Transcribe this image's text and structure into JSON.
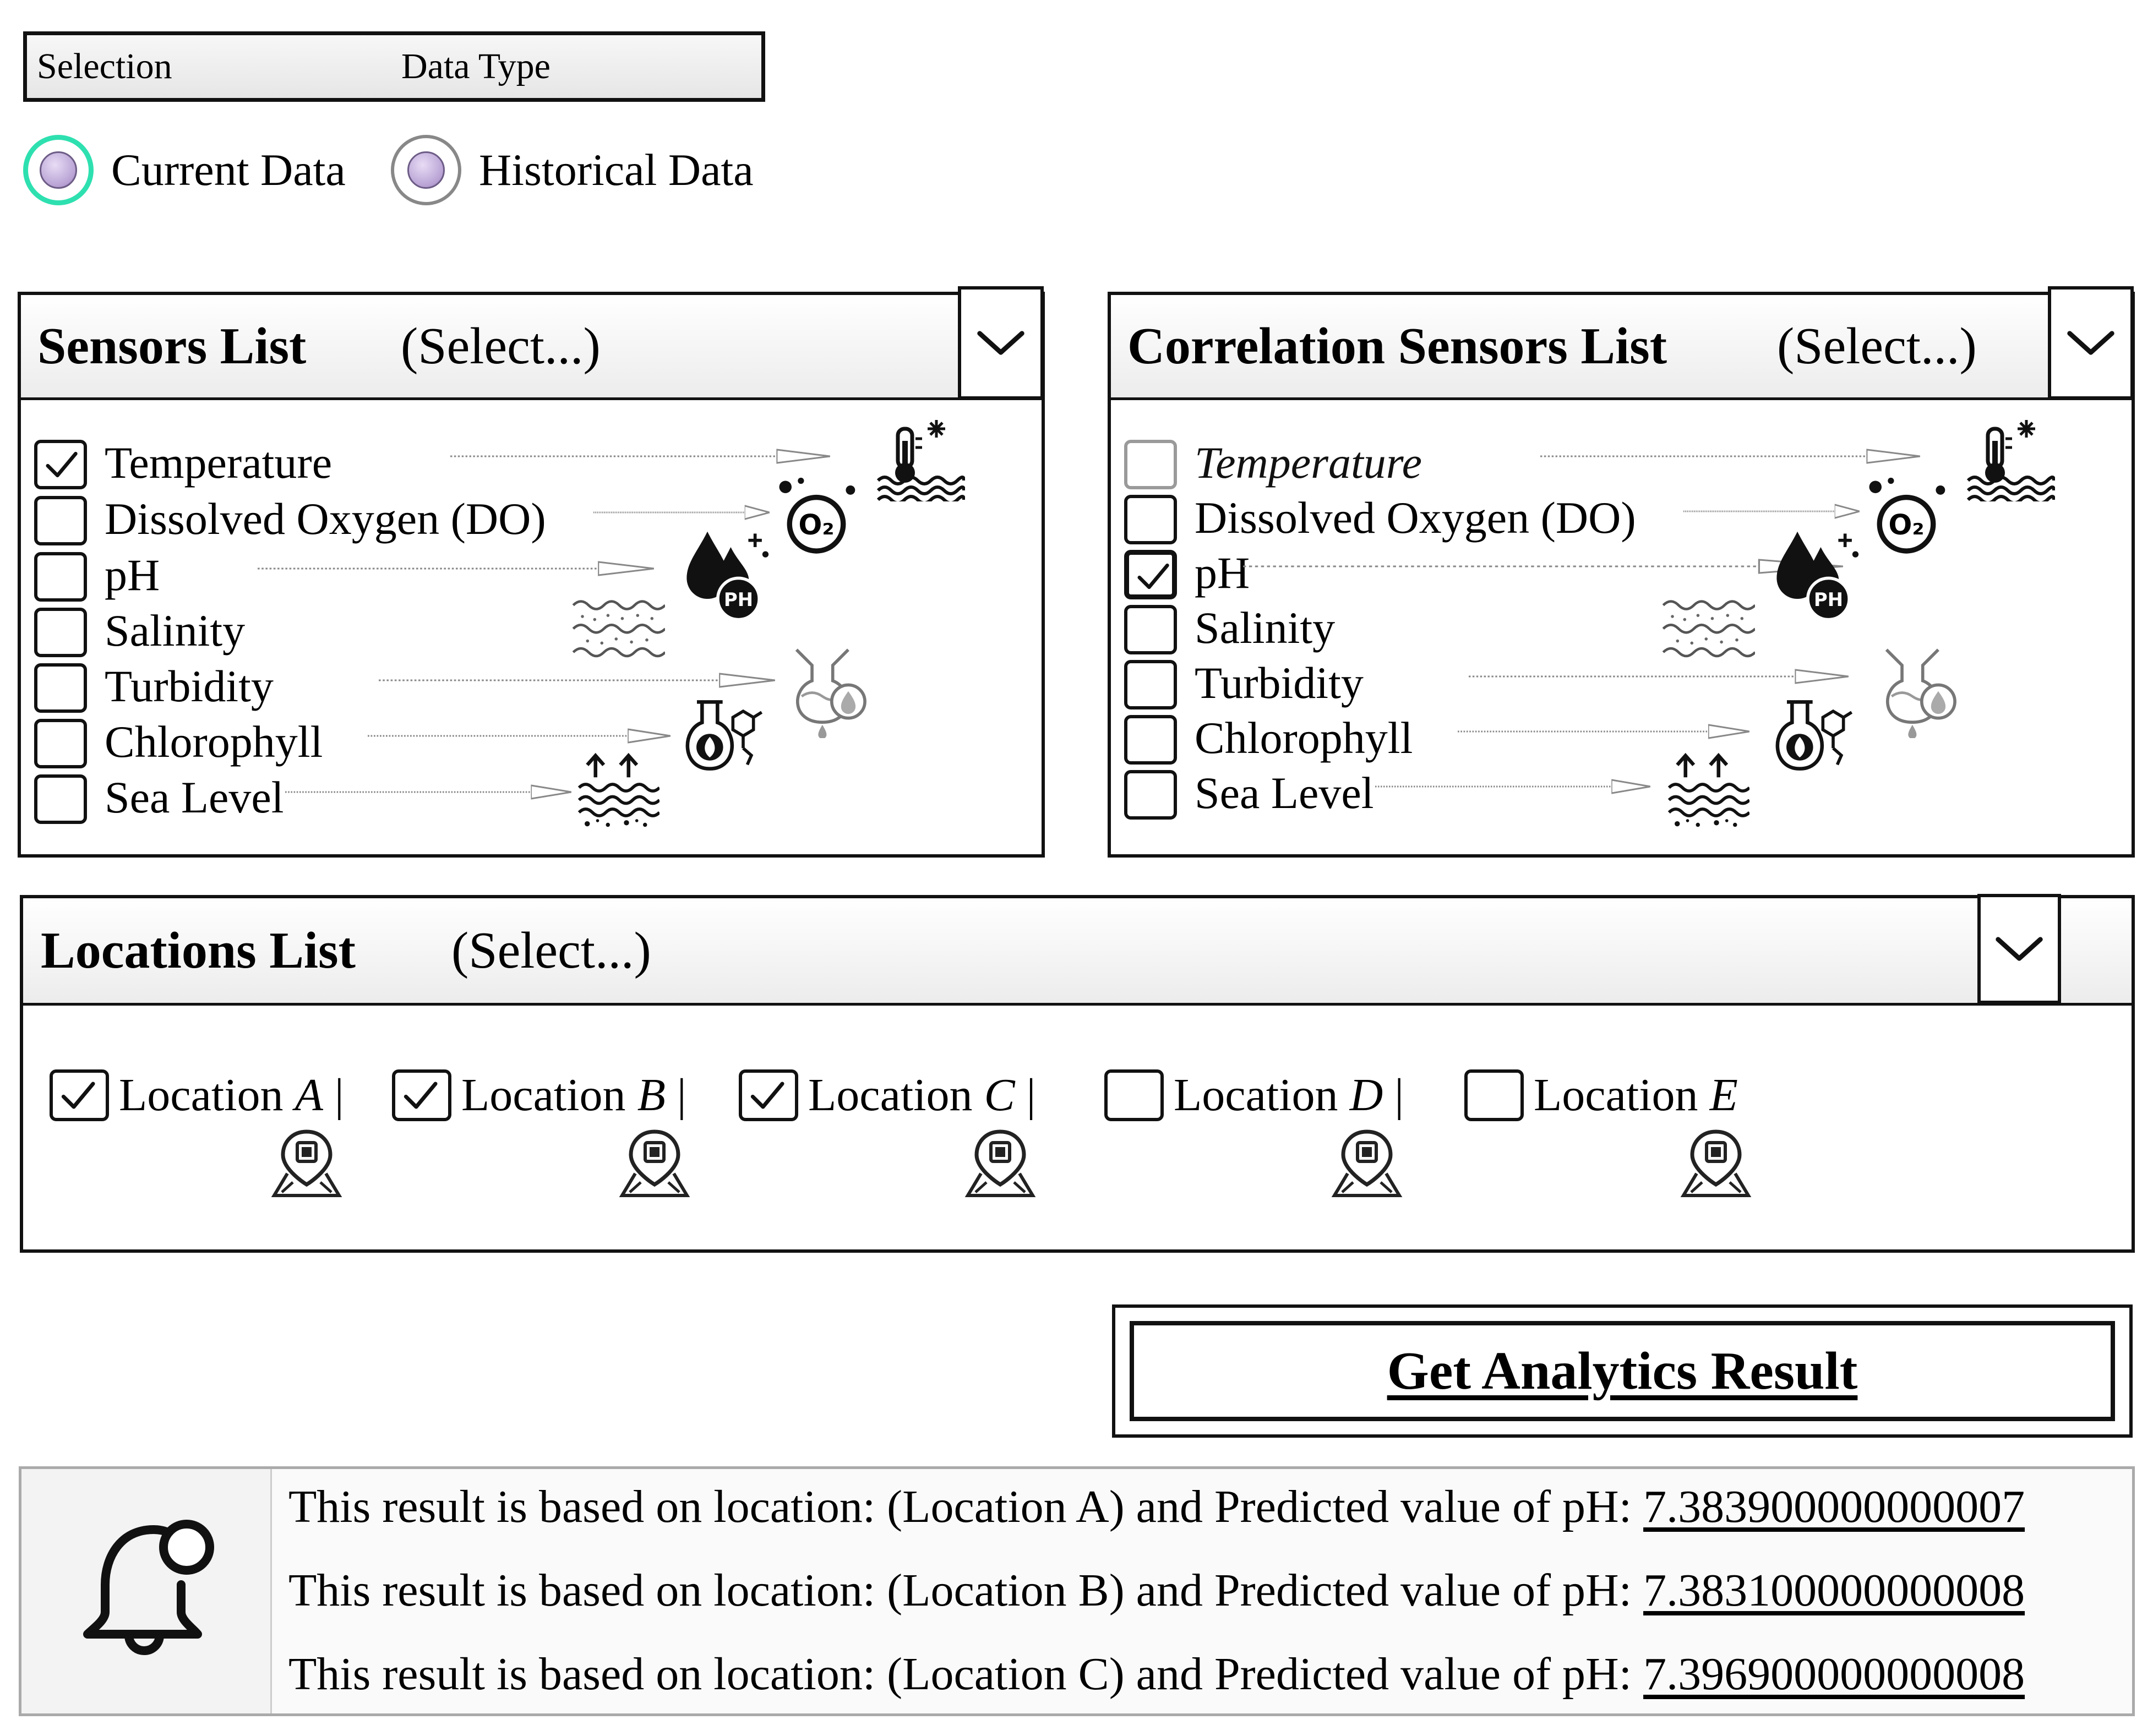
{
  "selection": {
    "label": "Selection",
    "data_type_label": "Data Type"
  },
  "data_type": {
    "options": [
      {
        "label": "Current Data",
        "selected": true
      },
      {
        "label": "Historical Data",
        "selected": false
      }
    ]
  },
  "sensors": {
    "title": "Sensors List",
    "select_label": "(Select...)",
    "items": [
      {
        "label": "Temperature",
        "checked": true,
        "icon": "thermometer-water-icon"
      },
      {
        "label": "Dissolved Oxygen (DO)",
        "checked": false,
        "icon": "oxygen-bubbles-icon"
      },
      {
        "label": "pH",
        "checked": false,
        "icon": "ph-drops-icon"
      },
      {
        "label": "Salinity",
        "checked": false,
        "icon": "salinity-waves-icon"
      },
      {
        "label": "Turbidity",
        "checked": false,
        "icon": "turbidity-flask-icon"
      },
      {
        "label": "Chlorophyll",
        "checked": false,
        "icon": "chlorophyll-leaf-flask-icon"
      },
      {
        "label": "Sea Level",
        "checked": false,
        "icon": "sea-level-rise-icon"
      }
    ]
  },
  "correlation": {
    "title": "Correlation Sensors List",
    "select_label": "(Select...)",
    "items": [
      {
        "label": "Temperature",
        "checked": false,
        "disabled": true
      },
      {
        "label": "Dissolved Oxygen (DO)",
        "checked": false
      },
      {
        "label": "pH",
        "checked": true
      },
      {
        "label": "Salinity",
        "checked": false
      },
      {
        "label": "Turbidity",
        "checked": false
      },
      {
        "label": "Chlorophyll",
        "checked": false
      },
      {
        "label": "Sea Level",
        "checked": false
      }
    ]
  },
  "locations": {
    "title": "Locations List",
    "select_label": "(Select...)",
    "prefix": "Location",
    "separator": "|",
    "items": [
      {
        "letter": "A",
        "checked": true
      },
      {
        "letter": "B",
        "checked": true
      },
      {
        "letter": "C",
        "checked": true
      },
      {
        "letter": "D",
        "checked": false
      },
      {
        "letter": "E",
        "checked": false
      }
    ]
  },
  "action": {
    "label": "Get Analytics Result"
  },
  "results": {
    "lines": [
      {
        "text": "This result is based on location: (Location A) and Predicted value of pH: ",
        "value": "7.383900000000007"
      },
      {
        "text": "This result is based on location: (Location B) and Predicted value of pH: ",
        "value": "7.383100000000008"
      },
      {
        "text": "This result is based on location: (Location C) and Predicted value of pH: ",
        "value": "7.396900000000008"
      }
    ]
  },
  "colors": {
    "radio_selected_ring": "#2ee0b0",
    "radio_dot": "#b8a2d4",
    "border": "#111111"
  }
}
